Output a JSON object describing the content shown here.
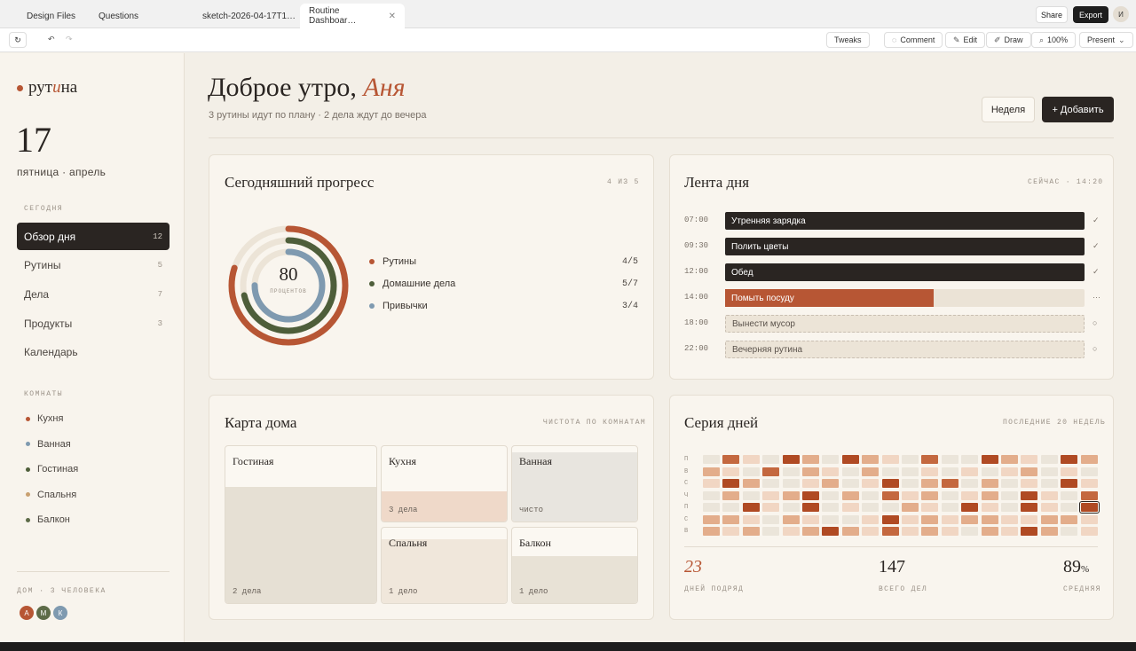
{
  "browser": {
    "tabs": [
      "Design Files",
      "Questions",
      "sketch-2026-04-17T1…",
      "Routine Dashboar…"
    ],
    "share": "Share",
    "export": "Export",
    "user_initial": "И"
  },
  "toolbar": {
    "tweaks": "Tweaks",
    "comment": "Comment",
    "edit": "Edit",
    "draw": "Draw",
    "zoom": "100%",
    "present": "Present"
  },
  "sidebar": {
    "logo_pre": "рут",
    "logo_em": "и",
    "logo_post": "на",
    "day": "17",
    "date_sub": "пятница · апрель",
    "today_label": "СЕГОДНЯ",
    "nav": [
      {
        "label": "Обзор дня",
        "count": "12"
      },
      {
        "label": "Рутины",
        "count": "5"
      },
      {
        "label": "Дела",
        "count": "7"
      },
      {
        "label": "Продукты",
        "count": "3"
      },
      {
        "label": "Календарь",
        "count": ""
      }
    ],
    "rooms_label": "КОМНАТЫ",
    "rooms": [
      {
        "label": "Кухня",
        "color": "#b75634"
      },
      {
        "label": "Ванная",
        "color": "#7f9ab0"
      },
      {
        "label": "Гостиная",
        "color": "#4e5e3a"
      },
      {
        "label": "Спальня",
        "color": "#c9a070"
      },
      {
        "label": "Балкон",
        "color": "#5d6b48"
      }
    ],
    "home_label": "ДОМ · 3 ЧЕЛОВЕКА",
    "avatars": [
      {
        "initial": "А",
        "color": "#b75634"
      },
      {
        "initial": "М",
        "color": "#5d6b48"
      },
      {
        "initial": "К",
        "color": "#7f9ab0"
      }
    ]
  },
  "header": {
    "greeting": "Доброе утро,",
    "name": "Аня",
    "subtitle": "3 рутины идут по плану · 2 дела ждут до вечера",
    "week_button": "Неделя",
    "add_button": "+ Добавить"
  },
  "progress": {
    "title": "Сегодняшний прогресс",
    "meta": "4 ИЗ 5",
    "center_value": "80",
    "center_label": "ПРОЦЕНТОВ",
    "items": [
      {
        "label": "Рутины",
        "value": "4/5",
        "color": "#b75634",
        "fraction": 0.8
      },
      {
        "label": "Домашние дела",
        "value": "5/7",
        "color": "#4e5e3a",
        "fraction": 0.714
      },
      {
        "label": "Привычки",
        "value": "3/4",
        "color": "#7f9ab0",
        "fraction": 0.75
      }
    ]
  },
  "timeline": {
    "title": "Лента дня",
    "meta": "СЕЙЧАС · 14:20",
    "rows": [
      {
        "time": "07:00",
        "label": "Утренняя зарядка",
        "mark": "✓",
        "state": "done"
      },
      {
        "time": "09:30",
        "label": "Полить цветы",
        "mark": "✓",
        "state": "done"
      },
      {
        "time": "12:00",
        "label": "Обед",
        "mark": "✓",
        "state": "done"
      },
      {
        "time": "14:00",
        "label": "Помыть посуду",
        "mark": "···",
        "state": "active",
        "fraction": 0.58
      },
      {
        "time": "18:00",
        "label": "Вынести мусор",
        "mark": "○",
        "state": "pending"
      },
      {
        "time": "22:00",
        "label": "Вечерняя рутина",
        "mark": "○",
        "state": "pending"
      }
    ]
  },
  "home_map": {
    "title": "Карта дома",
    "meta": "ЧИСТОТА ПО КОМНАТАМ",
    "rooms": [
      {
        "name": "Гостиная",
        "info": "2 дела",
        "fill": 0.74,
        "color": "#e6e0d4"
      },
      {
        "name": "Кухня",
        "info": "3 дела",
        "fill": 0.4,
        "color": "#efd9c9"
      },
      {
        "name": "Ванная",
        "info": "чисто",
        "fill": 0.92,
        "color": "#e8e5df"
      },
      {
        "name": "Спальня",
        "info": "1 дело",
        "fill": 0.85,
        "color": "#f0e7db"
      },
      {
        "name": "Балкон",
        "info": "1 дело",
        "fill": 0.62,
        "color": "#e8e2d6"
      }
    ]
  },
  "streak": {
    "title": "Серия дней",
    "meta": "ПОСЛЕДНИЕ 20 НЕДЕЛЬ",
    "day_labels": [
      "П",
      "В",
      "С",
      "Ч",
      "П",
      "С",
      "В"
    ],
    "colors": [
      "#ebe5da",
      "#f1d6c3",
      "#e3ad8b",
      "#c4683f",
      "#b04a23"
    ],
    "grid": [
      [
        0,
        3,
        1,
        0,
        4,
        2,
        0,
        4,
        2,
        1,
        0,
        3,
        0,
        0,
        4,
        2,
        1,
        0,
        4,
        2
      ],
      [
        2,
        1,
        0,
        3,
        0,
        2,
        1,
        0,
        2,
        0,
        0,
        1,
        0,
        1,
        0,
        1,
        2,
        0,
        1,
        0
      ],
      [
        1,
        4,
        2,
        0,
        0,
        1,
        2,
        0,
        1,
        4,
        0,
        2,
        3,
        0,
        2,
        0,
        1,
        0,
        4,
        1
      ],
      [
        0,
        2,
        0,
        1,
        2,
        4,
        0,
        2,
        0,
        3,
        1,
        2,
        0,
        1,
        2,
        0,
        4,
        1,
        0,
        3
      ],
      [
        0,
        0,
        4,
        1,
        0,
        4,
        0,
        1,
        0,
        0,
        2,
        1,
        0,
        4,
        1,
        0,
        4,
        1,
        0,
        3
      ],
      [
        2,
        2,
        1,
        0,
        2,
        1,
        0,
        0,
        1,
        4,
        1,
        2,
        1,
        2,
        2,
        1,
        1,
        2,
        2,
        1
      ],
      [
        2,
        1,
        2,
        0,
        1,
        2,
        4,
        2,
        1,
        3,
        1,
        2,
        1,
        0,
        2,
        1,
        4,
        2,
        0,
        1
      ]
    ],
    "highlight": {
      "row": 4,
      "col": 19
    },
    "stats": [
      {
        "value": "23",
        "label": "ДНЕЙ ПОДРЯД"
      },
      {
        "value": "147",
        "label": "ВСЕГО ДЕЛ"
      },
      {
        "value": "89",
        "unit": "%",
        "label": "СРЕДНЯЯ"
      }
    ]
  }
}
